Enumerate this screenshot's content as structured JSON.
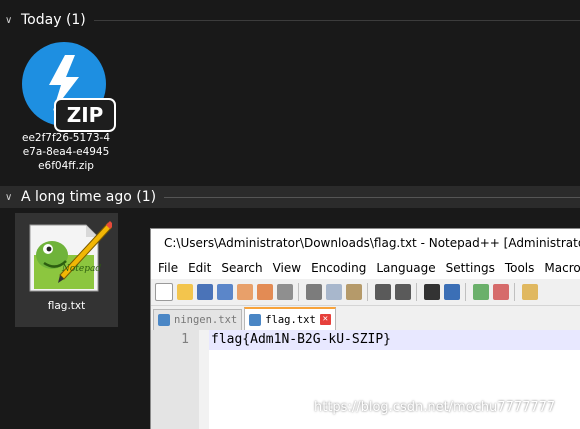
{
  "explorer": {
    "groups": [
      {
        "label": "Today (1)"
      },
      {
        "label": "A long time ago (1)"
      }
    ],
    "files": [
      {
        "name": "ee2f7f26-5173-4e7a-8ea4-e4945e6f04ff.zip",
        "icon": "zip-archive-icon",
        "badge": "ZIP"
      },
      {
        "name": "flag.txt",
        "icon": "notepadplusplus-file-icon"
      }
    ]
  },
  "notepad": {
    "title": "C:\\Users\\Administrator\\Downloads\\flag.txt - Notepad++ [Administrator]",
    "menu": [
      "File",
      "Edit",
      "Search",
      "View",
      "Encoding",
      "Language",
      "Settings",
      "Tools",
      "Macro"
    ],
    "tabs": [
      {
        "label": "ningen.txt",
        "active": false
      },
      {
        "label": "flag.txt",
        "active": true
      }
    ],
    "line_number": "1",
    "content": "flag{Adm1N-B2G-kU-SZIP}"
  },
  "watermark": "https://blog.csdn.net/mochu7777777",
  "colors": {
    "background": "#191919",
    "selected_item": "#333333",
    "zip_blue": "#1e8fe1",
    "tab_accent": "#f8a33b"
  }
}
